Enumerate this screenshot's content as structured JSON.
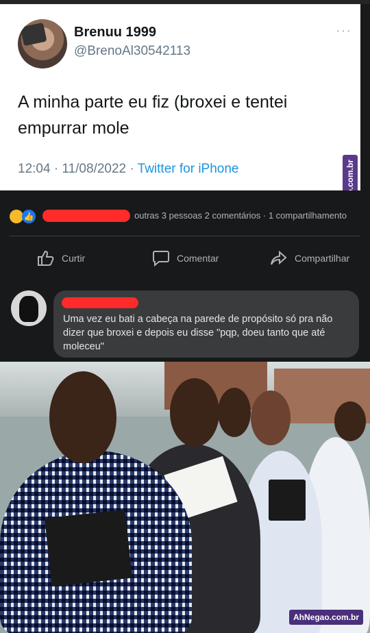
{
  "tweet": {
    "name": "Brenuu 1999",
    "handle": "@BrenoAl30542113",
    "more": "···",
    "text": "A minha parte eu fiz (broxei e tentei empurrar mole",
    "time_date": "12:04 · 11/08/2022 · ",
    "source": "Twitter for iPhone"
  },
  "watermark": {
    "side": "AhNegao.com.br",
    "bottom": "AhNegao.com.br"
  },
  "facebook": {
    "stats": "outras 3 pessoas   2 comentários  ·  1 compartilhamento",
    "actions": {
      "like": "Curtir",
      "comment": "Comentar",
      "share": "Compartilhar"
    },
    "comment": {
      "text": "Uma vez eu bati a cabeça na parede de propósito só pra não dizer que broxei e depois eu disse \"pqp, doeu tanto que até moleceu\""
    }
  },
  "colors": {
    "fb_background": "#18191a",
    "bubble": "#3a3b3c",
    "redaction": "#ff2a2a",
    "twitter_link": "#1b95e0"
  }
}
